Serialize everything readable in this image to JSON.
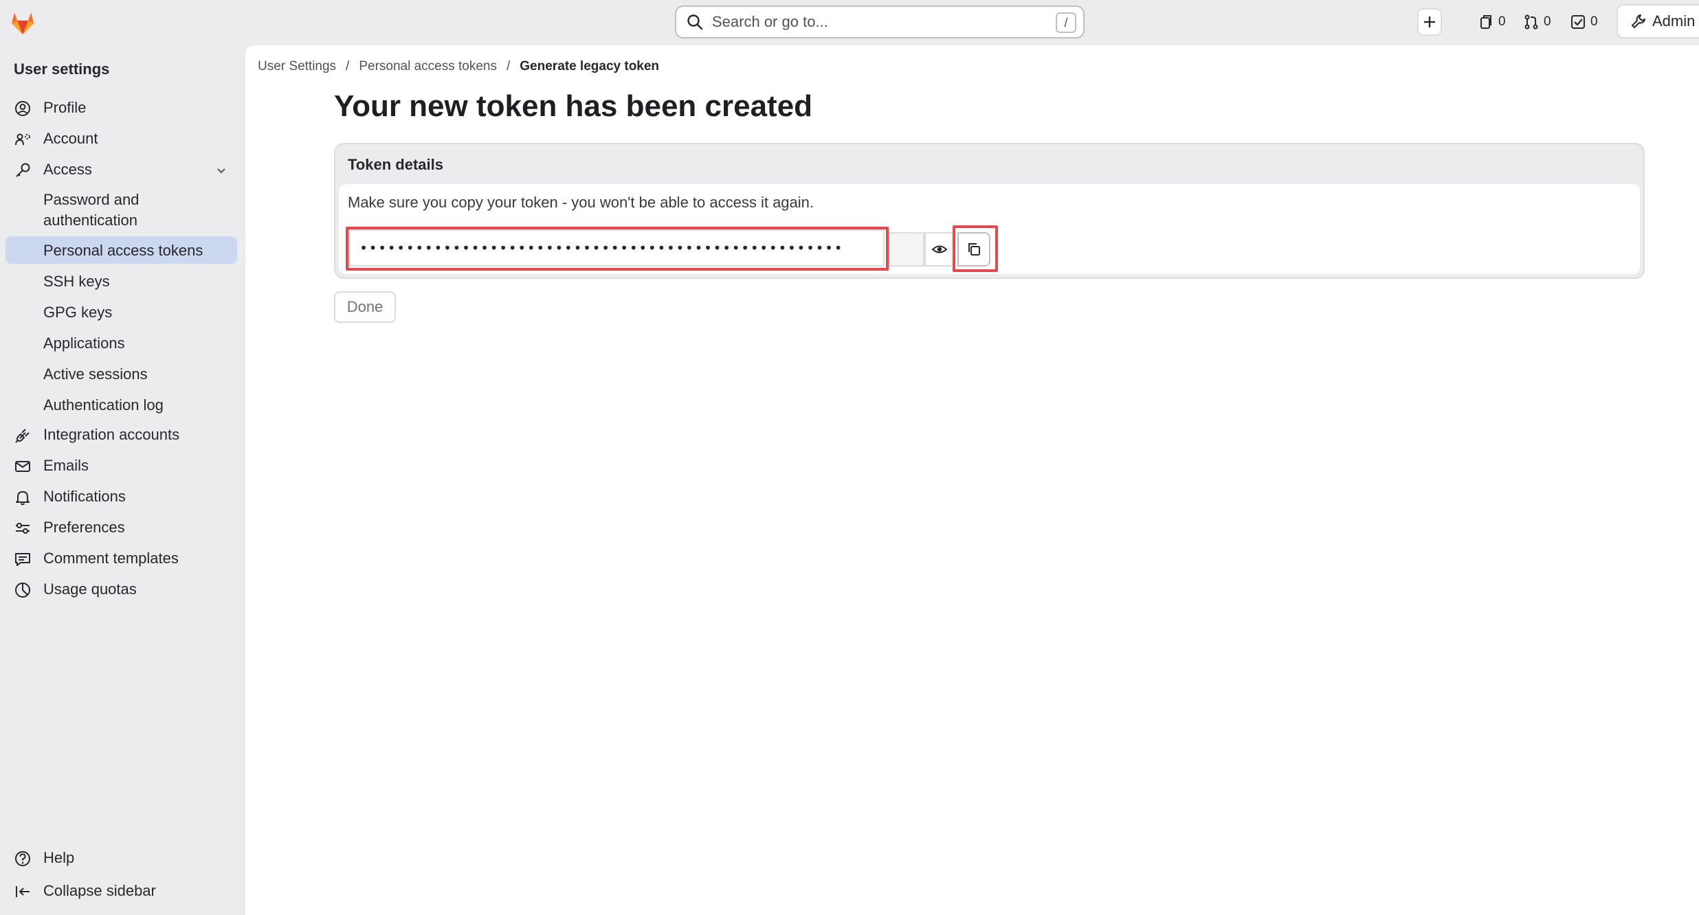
{
  "topbar": {
    "search_placeholder": "Search or go to...",
    "search_shortcut": "/",
    "issues_count": "0",
    "merge_requests_count": "0",
    "todos_count": "0",
    "admin_label": "Admin"
  },
  "sidebar": {
    "title": "User settings",
    "items": [
      {
        "label": "Profile",
        "icon": "profile-icon"
      },
      {
        "label": "Account",
        "icon": "account-icon"
      },
      {
        "label": "Access",
        "icon": "key-icon"
      }
    ],
    "access_subitems": [
      {
        "label": "Password and authentication"
      },
      {
        "label": "Personal access tokens"
      },
      {
        "label": "SSH keys"
      },
      {
        "label": "GPG keys"
      },
      {
        "label": "Applications"
      },
      {
        "label": "Active sessions"
      },
      {
        "label": "Authentication log"
      }
    ],
    "more_items": [
      {
        "label": "Integration accounts",
        "icon": "plug-icon"
      },
      {
        "label": "Emails",
        "icon": "mail-icon"
      },
      {
        "label": "Notifications",
        "icon": "bell-icon"
      },
      {
        "label": "Preferences",
        "icon": "preferences-icon"
      },
      {
        "label": "Comment templates",
        "icon": "comment-icon"
      },
      {
        "label": "Usage quotas",
        "icon": "quota-icon"
      }
    ],
    "help_label": "Help",
    "collapse_label": "Collapse sidebar"
  },
  "breadcrumb": {
    "items": [
      "User Settings",
      "Personal access tokens",
      "Generate legacy token"
    ],
    "separator": "/"
  },
  "main": {
    "title": "Your new token has been created",
    "card_title": "Token details",
    "card_description": "Make sure you copy your token - you won't be able to access it again.",
    "token_masked": "••••••••••••••••••••••••••••••••••••••••••••••••••••",
    "done_label": "Done"
  },
  "colors": {
    "accent_active": "#cbd8ef",
    "highlight": "#e5484d",
    "background": "#ececef"
  }
}
